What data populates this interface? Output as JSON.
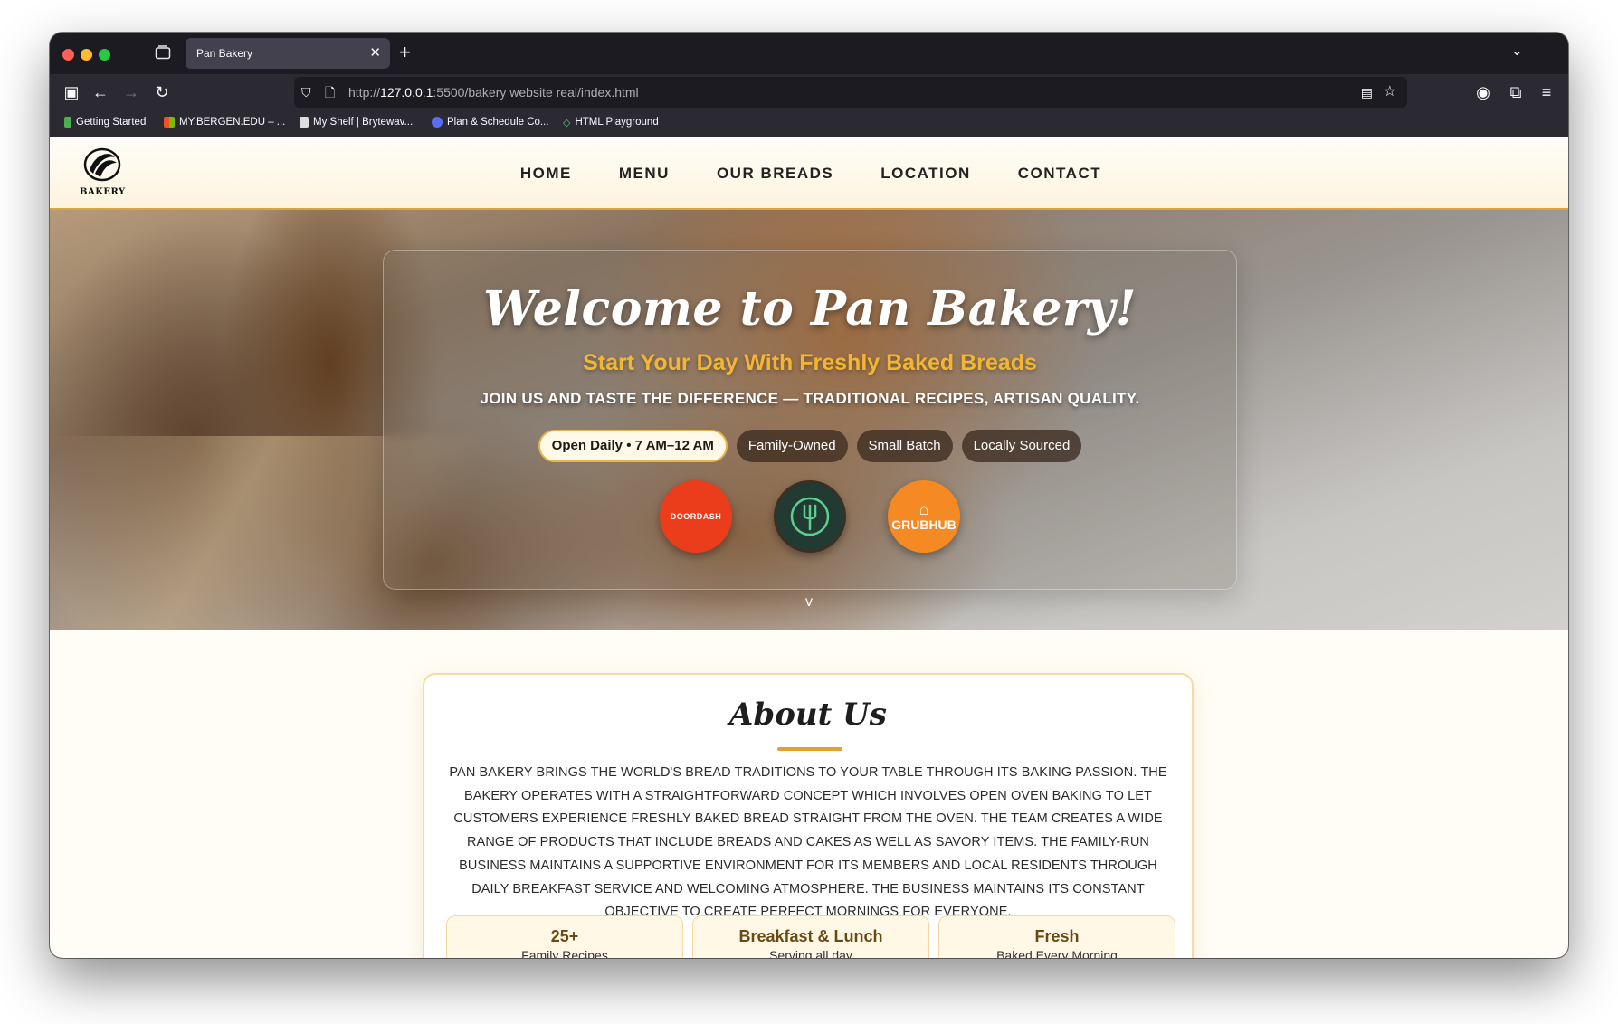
{
  "browser": {
    "tab_title": "Pan Bakery",
    "url_prefix": "http://",
    "url_host": "127.0.0.1",
    "url_rest": ":5500/bakery website real/index.html",
    "bookmarks": [
      {
        "label": "Getting Started",
        "color": "#4caf50"
      },
      {
        "label": "MY.BERGEN.EDU – ...",
        "color": "#e8a21a"
      },
      {
        "label": "My Shelf | Brytewav...",
        "color": "#dddddd"
      },
      {
        "label": "Plan & Schedule Co...",
        "color": "#5b6cf5"
      },
      {
        "label": "HTML Playground",
        "color": "#5fcf80"
      }
    ]
  },
  "site": {
    "logo_text": "BAKERY",
    "nav": [
      "HOME",
      "MENU",
      "OUR BREADS",
      "LOCATION",
      "CONTACT"
    ]
  },
  "hero": {
    "title": "Welcome to Pan Bakery!",
    "subtitle": "Start Your Day With Freshly Baked Breads",
    "tagline": "JOIN US AND TASTE THE DIFFERENCE — TRADITIONAL RECIPES, ARTISAN QUALITY.",
    "pills": [
      "Open Daily • 7 AM–12 AM",
      "Family-Owned",
      "Small Batch",
      "Locally Sourced"
    ],
    "delivery": {
      "doordash": "DOORDASH",
      "grubhub": "GRUBHUB"
    },
    "scroll_icon": "chevron-down-icon",
    "scroll_glyph": "v"
  },
  "about": {
    "title": "About Us",
    "body": "PAN BAKERY BRINGS THE WORLD'S BREAD TRADITIONS TO YOUR TABLE THROUGH ITS BAKING PASSION. THE BAKERY OPERATES WITH A STRAIGHTFORWARD CONCEPT WHICH INVOLVES OPEN OVEN BAKING TO LET CUSTOMERS EXPERIENCE FRESHLY BAKED BREAD STRAIGHT FROM THE OVEN. THE TEAM CREATES A WIDE RANGE OF PRODUCTS THAT INCLUDE BREADS AND CAKES AS WELL AS SAVORY ITEMS. THE FAMILY-RUN BUSINESS MAINTAINS A SUPPORTIVE ENVIRONMENT FOR ITS MEMBERS AND LOCAL RESIDENTS THROUGH DAILY BREAKFAST SERVICE AND WELCOMING ATMOSPHERE. THE BUSINESS MAINTAINS ITS CONSTANT OBJECTIVE TO CREATE PERFECT MORNINGS FOR EVERYONE.",
    "stats": [
      {
        "value": "25+",
        "label": "Family Recipes"
      },
      {
        "value": "Breakfast & Lunch",
        "label": "Serving all day"
      },
      {
        "value": "Fresh",
        "label": "Baked Every Morning"
      }
    ]
  },
  "colors": {
    "accent": "#e4a12d",
    "subtitle_gold": "#f2b632",
    "doordash_red": "#eb3d1c",
    "grubhub_orange": "#f58a25"
  }
}
